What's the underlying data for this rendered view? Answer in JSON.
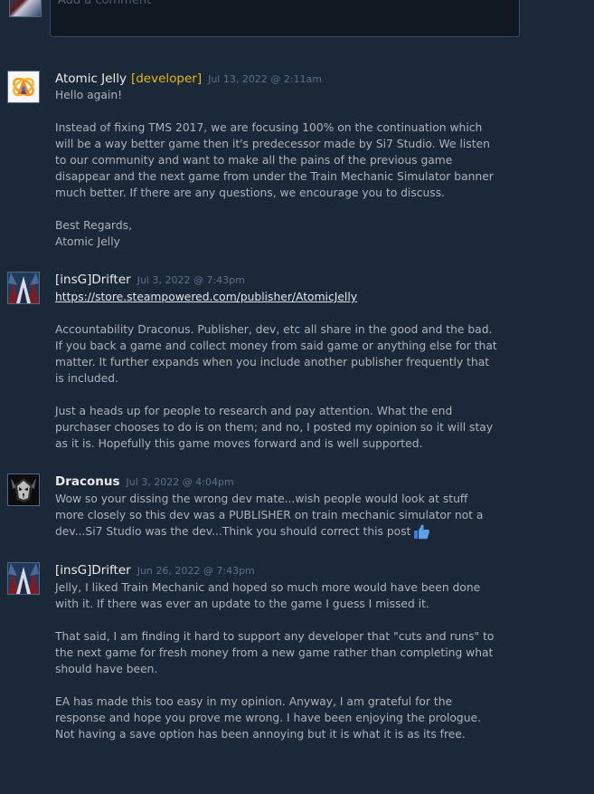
{
  "composer": {
    "placeholder": "Add a comment"
  },
  "comments": [
    {
      "author": "Atomic Jelly",
      "badge": "[developer]",
      "timestamp": "Jul 13, 2022 @ 2:11am",
      "avatar_icon": "atomic-jelly-logo-icon",
      "paragraphs": [
        "Hello again!",
        "Instead of fixing TMS 2017, we are focusing 100% on the continuation which will be a way better game then it's predecessor made by Si7 Studio. We listen to our community and want to make all the pains of the previous game disappear and the next game from under the Train Mechanic Simulator banner much better. If there are any questions, we encourage you to discuss.",
        "Best Regards,",
        "Atomic Jelly"
      ]
    },
    {
      "author": "[insG]Drifter",
      "timestamp": "Jul 3, 2022 @ 7:43pm",
      "avatar_icon": "drifter-avatar-icon",
      "link": "https://store.steampowered.com/publisher/AtomicJelly",
      "paragraphs": [
        "Accountability Draconus. Publisher, dev, etc all share in the good and the bad. If you back a game and collect money from said game or anything else for that matter. It further expands when you include another publisher frequently that is included.",
        "Just a heads up for people to research and pay attention. What the end purchaser chooses to do is on them; and no, I posted my opinion so it will stay as it is. Hopefully this game moves forward and is well supported."
      ]
    },
    {
      "author": "Draconus",
      "timestamp": "Jul 3, 2022 @ 4:04pm",
      "avatar_icon": "draconus-avatar-icon",
      "emoji": "thumbs-up-icon",
      "paragraphs": [
        "Wow so your dissing the wrong dev mate...wish people would look at stuff more closely so this dev was a PUBLISHER on train mechanic simulator not a dev...Si7 Studio was the dev...Think you should correct this post"
      ]
    },
    {
      "author": "[insG]Drifter",
      "timestamp": "Jun 26, 2022 @ 7:43pm",
      "avatar_icon": "drifter-avatar-icon",
      "paragraphs": [
        "Jelly, I liked Train Mechanic and hoped so much more would have been done with it. If there was ever an update to the game I guess I missed it.",
        "That said, I am finding it hard to support any developer that \"cuts and runs\" to the next game for fresh money from a new game rather than completing what should have been.",
        "EA has made this too easy in my opinion. Anyway, I am grateful for the response and hope you prove me wrong. I have been enjoying the prologue. Not having a save option has been annoying but it is what it is as its free."
      ]
    }
  ],
  "colors": {
    "background": "#1b2838",
    "author": "#ebebeb",
    "developer_badge": "#e5b70c",
    "timestamp": "#5b708a",
    "body_text": "#acb2b8"
  }
}
